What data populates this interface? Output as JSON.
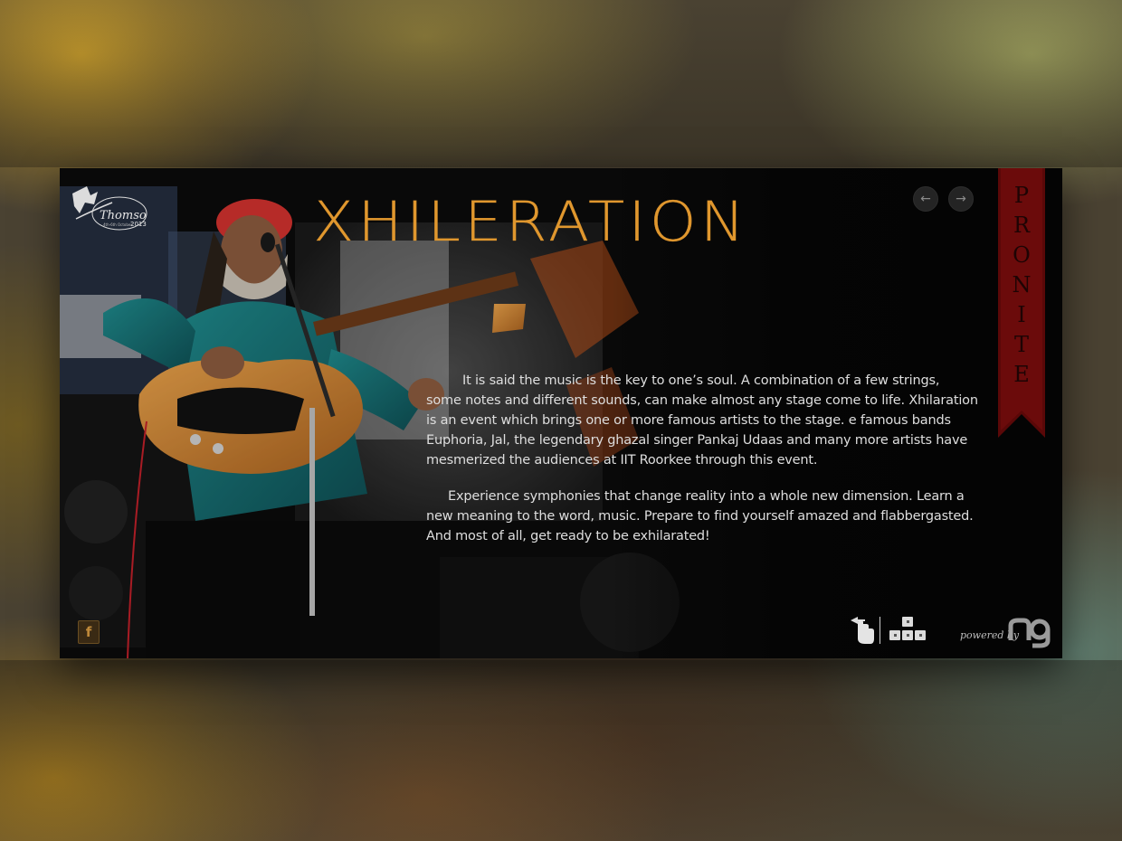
{
  "page": {
    "title": "XHILERATION",
    "ribbon_label": "PRONITE",
    "paragraphs": [
      "It is said the music is the key to one’s soul. A combination of a few strings, some notes and different sounds, can make almost any stage come to life. Xhilaration is an event which brings one or more famous artists to the stage. e famous bands Euphoria, Jal, the legendary ghazal singer Pankaj Udaas and many more artists have mesmerized the audiences at IIT Roorkee through this event.",
      "Experience symphonies that change reality into a whole new dimension. Learn a new meaning to the word, music. Prepare to find yourself amazed and flabbergasted. And most of all, get ready to be exhilarated!"
    ]
  },
  "logo": {
    "name": "Thomso",
    "year": "2013",
    "dates": "4th-6th October"
  },
  "nav": {
    "prev_icon": "arrow-left-icon",
    "next_icon": "arrow-right-icon",
    "prev_glyph": "←",
    "next_glyph": "→"
  },
  "footer": {
    "facebook_glyph": "f",
    "powered_by": "powered by",
    "hand_icon": "hand-swipe-icon",
    "keys_icon": "arrow-keys-icon"
  },
  "colors": {
    "title": "#e0972e",
    "ribbon": "#5a0808",
    "body_text": "#dedede",
    "panel": "#050505"
  }
}
